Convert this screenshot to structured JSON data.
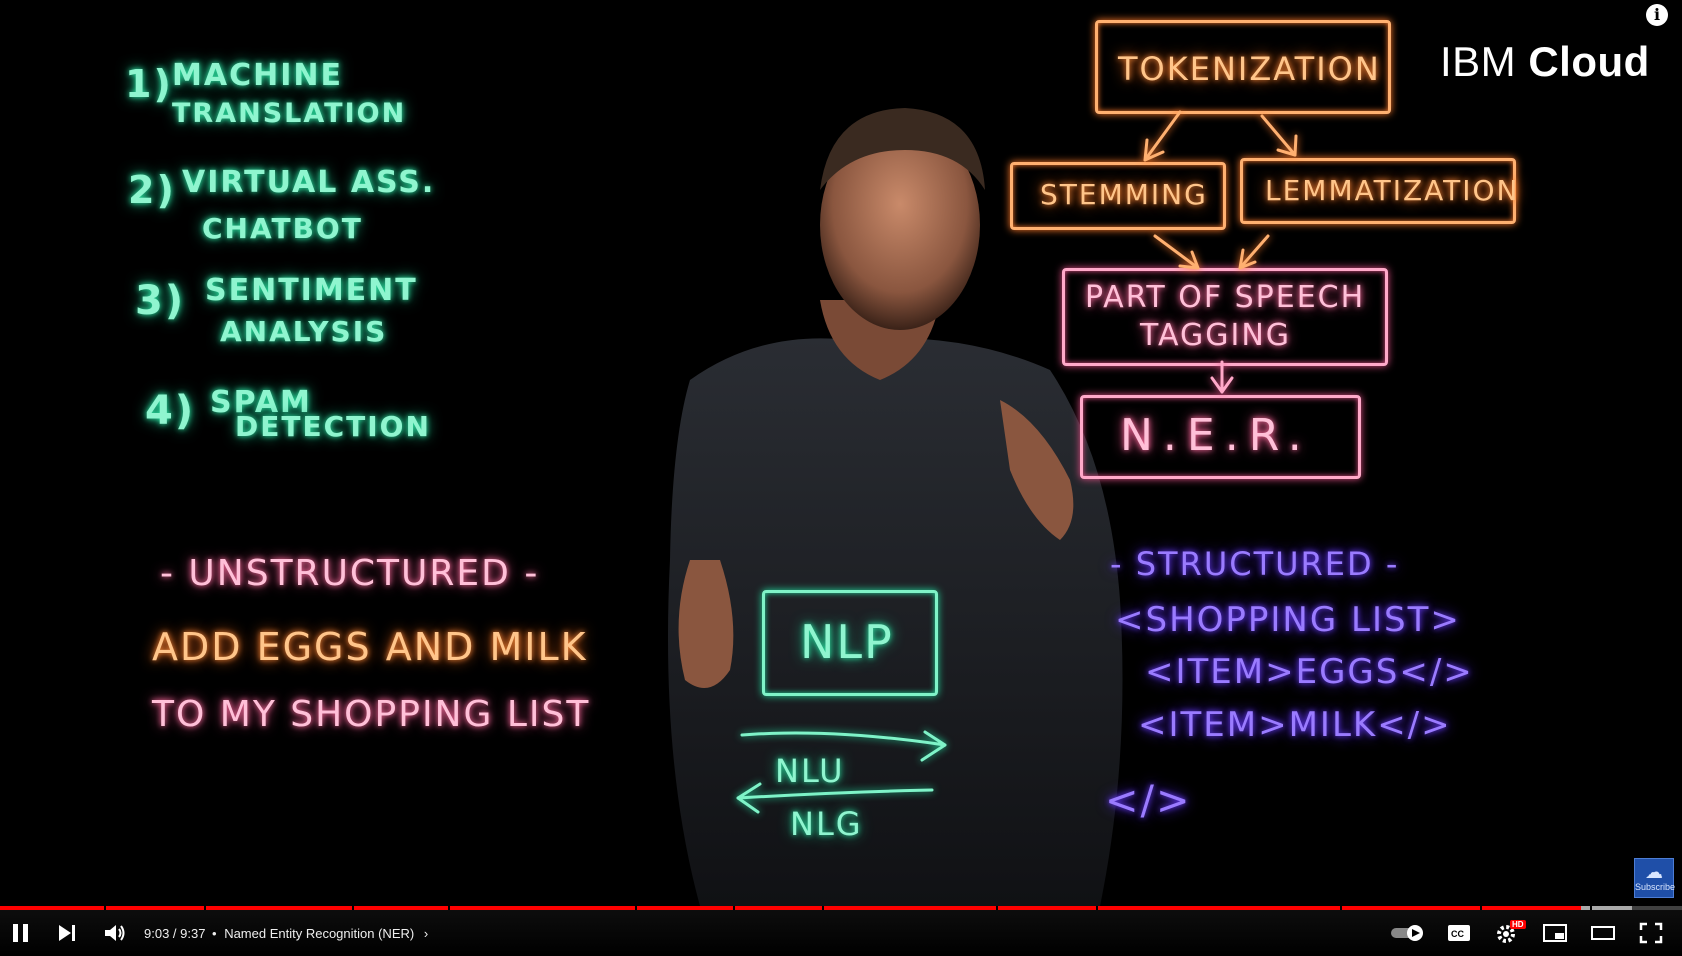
{
  "video": {
    "brand": {
      "light": "IBM",
      "bold": "Cloud"
    },
    "applications": [
      {
        "num": "1)",
        "line1": "MACHINE",
        "line2": "TRANSLATION"
      },
      {
        "num": "2)",
        "line1": "VIRTUAL ASS.",
        "line2": "CHATBOT"
      },
      {
        "num": "3)",
        "line1": "SENTIMENT",
        "line2": "ANALYSIS"
      },
      {
        "num": "4)",
        "line1": "SPAM",
        "line2": "DETECTION"
      }
    ],
    "unstructured": {
      "heading": "- UNSTRUCTURED -",
      "line1": "ADD EGGS AND MILK",
      "line2": "TO MY SHOPPING LIST"
    },
    "pipeline": {
      "step1": "TOKENIZATION",
      "step2a": "STEMMING",
      "step2b": "LEMMATIZATION",
      "step3_line1": "PART OF SPEECH",
      "step3_line2": "TAGGING",
      "step4": "N.E.R."
    },
    "nlp": {
      "box": "NLP",
      "nlu": "NLU",
      "nlg": "NLG"
    },
    "structured": {
      "heading": "- STRUCTURED -",
      "lines": [
        "<SHOPPING LIST>",
        "<ITEM>EGGS</>",
        "<ITEM>MILK</>",
        "</>"
      ]
    },
    "subscribe_label": "Subscribe"
  },
  "player": {
    "time": "9:03 / 9:37",
    "chapter_separator": "•",
    "chapter": "Named Entity Recognition (NER)",
    "progress_fraction": 0.94,
    "buffered_fraction": 0.97,
    "hd_badge": "HD",
    "accent_color": "#ff0000"
  }
}
